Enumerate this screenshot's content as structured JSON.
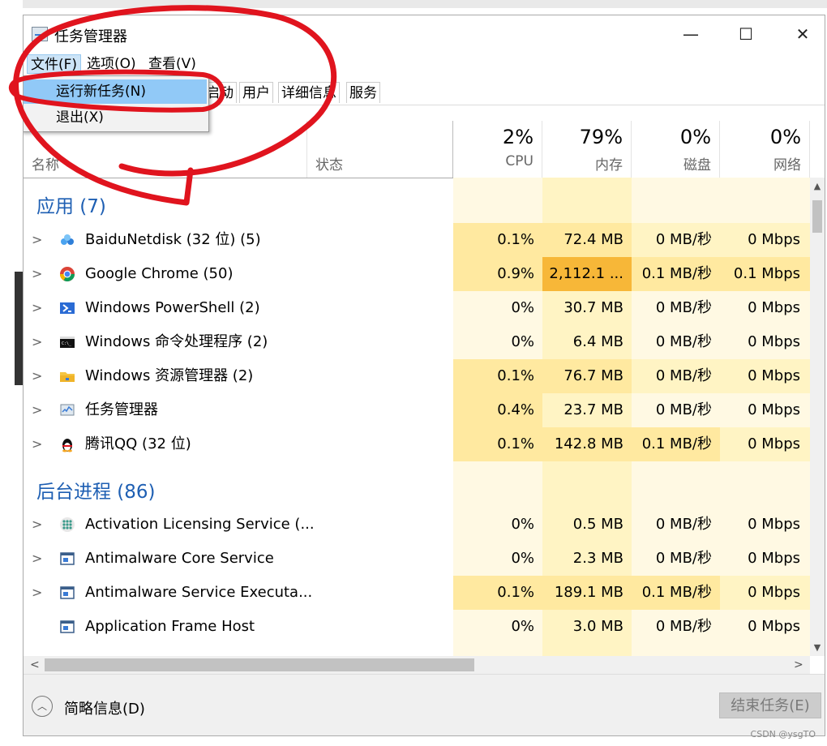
{
  "window": {
    "title": "任务管理器",
    "controls": {
      "minimize": "—",
      "maximize": "☐",
      "close": "✕"
    }
  },
  "menu": [
    "文件(F)",
    "选项(O)",
    "查看(V)"
  ],
  "file_menu": {
    "items": [
      "运行新任务(N)",
      "退出(X)"
    ],
    "highlighted": "运行新任务(N)"
  },
  "tabs": [
    "启动",
    "用户",
    "详细信息",
    "服务"
  ],
  "columns": {
    "name": "名称",
    "status": "状态",
    "cpu": {
      "pct": "2%",
      "label": "CPU"
    },
    "memory": {
      "pct": "79%",
      "label": "内存"
    },
    "disk": {
      "pct": "0%",
      "label": "磁盘"
    },
    "network": {
      "pct": "0%",
      "label": "网络"
    }
  },
  "groups": [
    {
      "title": "应用 (7)",
      "rows": [
        {
          "name": "BaiduNetdisk (32 位) (5)",
          "icon": "baidu-netdisk-icon",
          "expandable": true,
          "cpu": "0.1%",
          "mem": "72.4 MB",
          "disk": "0 MB/秒",
          "net": "0 Mbps"
        },
        {
          "name": "Google Chrome (50)",
          "icon": "chrome-icon",
          "expandable": true,
          "cpu": "0.9%",
          "mem": "2,112.1 ...",
          "disk": "0.1 MB/秒",
          "net": "0.1 Mbps"
        },
        {
          "name": "Windows PowerShell (2)",
          "icon": "powershell-icon",
          "expandable": true,
          "cpu": "0%",
          "mem": "30.7 MB",
          "disk": "0 MB/秒",
          "net": "0 Mbps"
        },
        {
          "name": "Windows 命令处理程序 (2)",
          "icon": "cmd-icon",
          "expandable": true,
          "cpu": "0%",
          "mem": "6.4 MB",
          "disk": "0 MB/秒",
          "net": "0 Mbps"
        },
        {
          "name": "Windows 资源管理器 (2)",
          "icon": "folder-icon",
          "expandable": true,
          "cpu": "0.1%",
          "mem": "76.7 MB",
          "disk": "0 MB/秒",
          "net": "0 Mbps"
        },
        {
          "name": "任务管理器",
          "icon": "task-manager-icon",
          "expandable": true,
          "cpu": "0.4%",
          "mem": "23.7 MB",
          "disk": "0 MB/秒",
          "net": "0 Mbps"
        },
        {
          "name": "腾讯QQ (32 位)",
          "icon": "qq-penguin-icon",
          "expandable": true,
          "cpu": "0.1%",
          "mem": "142.8 MB",
          "disk": "0.1 MB/秒",
          "net": "0 Mbps"
        }
      ]
    },
    {
      "title": "后台进程 (86)",
      "rows": [
        {
          "name": "Activation Licensing Service (...",
          "icon": "service-dots-icon",
          "expandable": true,
          "cpu": "0%",
          "mem": "0.5 MB",
          "disk": "0 MB/秒",
          "net": "0 Mbps"
        },
        {
          "name": "Antimalware Core Service",
          "icon": "service-window-icon",
          "expandable": true,
          "cpu": "0%",
          "mem": "2.3 MB",
          "disk": "0 MB/秒",
          "net": "0 Mbps"
        },
        {
          "name": "Antimalware Service Executa...",
          "icon": "service-window-icon",
          "expandable": true,
          "cpu": "0.1%",
          "mem": "189.1 MB",
          "disk": "0.1 MB/秒",
          "net": "0 Mbps"
        },
        {
          "name": "Application Frame Host",
          "icon": "service-window-icon",
          "expandable": false,
          "cpu": "0%",
          "mem": "3.0 MB",
          "disk": "0 MB/秒",
          "net": "0 Mbps"
        }
      ]
    }
  ],
  "footer": {
    "fewer_details": "简略信息(D)",
    "end_task": "结束任务(E)"
  },
  "watermark": "CSDN @ysgTO",
  "colors": {
    "annotation": "#e0141e",
    "group_title": "#1e5fb3",
    "heat_light": "#fff4c4",
    "heat_medium": "#ffe9a0",
    "heat_high": "#f7b738",
    "menu_highlight": "#91c9f7"
  }
}
